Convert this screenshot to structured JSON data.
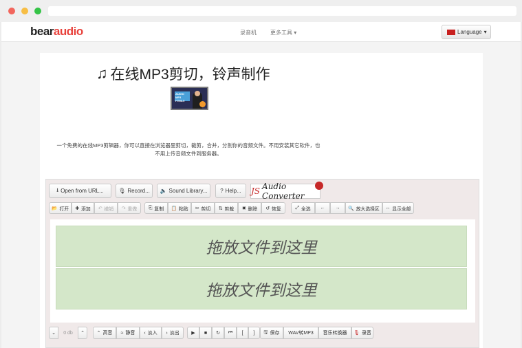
{
  "navbar": {
    "logo_bear": "bear",
    "logo_audio": "audio",
    "links": [
      "录音机",
      "更多工具"
    ],
    "language_button": "Language"
  },
  "hero": {
    "title": "在线MP3剪切，铃声制作",
    "thumbnail_text": "AUDIO MP3 HTML5",
    "description_line1": "一个免费的在线MP3剪辑器，你可以直接在浏览器里剪切，裁剪，合并，分割你的音频文件。不用安装其它软件，也",
    "description_line2": "不用上传音频文件到服务器。"
  },
  "editor": {
    "top_buttons": [
      "Open from URL...",
      "Record...",
      "Sound Library...",
      "Help..."
    ],
    "js_audio_converter": {
      "js": "JS",
      "rest": "Audio Converter"
    },
    "toolbar_groups": [
      [
        "打开",
        "添加",
        "撤销",
        "重做"
      ],
      [
        "复制",
        "粘贴",
        "剪切",
        "剪裁",
        "删除",
        "恢复"
      ],
      [
        "全选",
        "←",
        "→",
        "放大选择区",
        "显示全部"
      ]
    ],
    "drop_zone_1": "拖放文件到这里",
    "drop_zone_2": "拖放文件到这里",
    "db_value": "0 db",
    "bottom_effects": [
      "高音",
      "静音",
      "淡入",
      "淡出"
    ],
    "bottom_transport": [
      "▶",
      "■",
      "↻",
      "⏮",
      "[",
      "]"
    ],
    "bottom_actions": [
      "保存",
      "WAV转MP3",
      "音乐转换器",
      "录音"
    ]
  },
  "colors": {
    "logo_accent": "#e8413b",
    "drop_zone": "#d4e7c9",
    "editor_bg": "#f0e9e9"
  }
}
